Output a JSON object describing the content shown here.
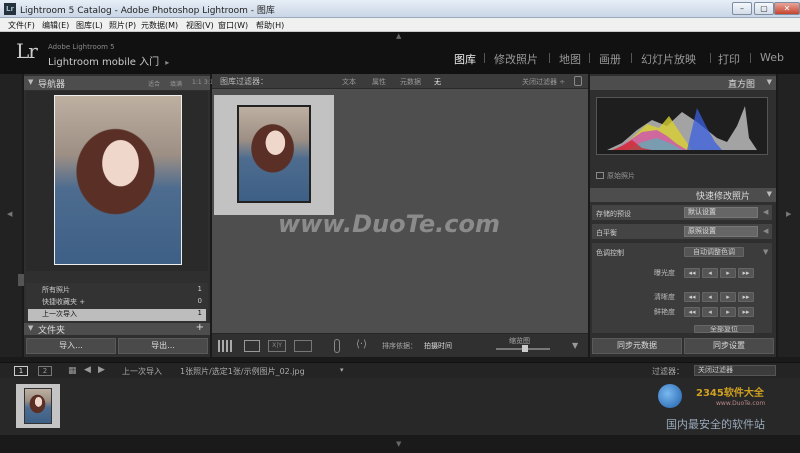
{
  "window": {
    "title": "Lightroom 5 Catalog - Adobe Photoshop Lightroom - 图库",
    "app_icon": "Lr"
  },
  "menu": [
    "文件(F)",
    "编辑(E)",
    "图库(L)",
    "照片(P)",
    "元数据(M)",
    "视图(V)",
    "窗口(W)",
    "帮助(H)"
  ],
  "identity": {
    "logo": "Lr",
    "line1": "Adobe Lightroom 5",
    "line2": "Lightroom mobile 入门",
    "arrow": "▸"
  },
  "modules": [
    "图库",
    "修改照片",
    "地图",
    "画册",
    "幻灯片放映",
    "打印",
    "Web"
  ],
  "left": {
    "navigator": {
      "title": "导航器",
      "zoom": [
        "适合",
        "填满",
        "1:1",
        "3:1"
      ]
    },
    "catalog": [
      {
        "label": "所有照片",
        "count": "1"
      },
      {
        "label": "快捷收藏夹 +",
        "count": "0"
      },
      {
        "label": "上一次导入",
        "count": "1"
      }
    ],
    "folders_title": "文件夹",
    "import": "导入...",
    "export": "导出..."
  },
  "filter": {
    "title": "图库过滤器：",
    "options": [
      "文本",
      "属性",
      "元数据",
      "无"
    ],
    "off": "关闭过滤器 ÷"
  },
  "toolbar": {
    "sort_label": "排序依据：",
    "sort_value": "拍摄时间",
    "thumb_label": "缩览图"
  },
  "right": {
    "histogram_title": "直方图",
    "original_photo": "原始照片",
    "quick_develop_title": "快速修改照片",
    "saved_preset_label": "存储的预设",
    "saved_preset_value": "默认设置",
    "wb_label": "白平衡",
    "wb_value": "原照设置",
    "tone_label": "色调控制",
    "auto_tone": "自动调整色调",
    "exposure": "曝光度",
    "clarity": "清晰度",
    "vibrance": "鲜艳度",
    "reset": "全部复位",
    "sync_meta": "同步元数据",
    "sync_settings": "同步设置"
  },
  "filmstrip": {
    "pages": [
      "1",
      "2"
    ],
    "source": "上一次导入",
    "info": "1张照片/选定1张/示例图片_02.jpg",
    "filter_label": "过滤器：",
    "filter_value": "关闭过滤器"
  },
  "watermark": {
    "main": "www.DuoTe.com",
    "site": "www.DuoTe.com",
    "brand": "2345软件大全",
    "tagline": "国内最安全的软件站"
  }
}
